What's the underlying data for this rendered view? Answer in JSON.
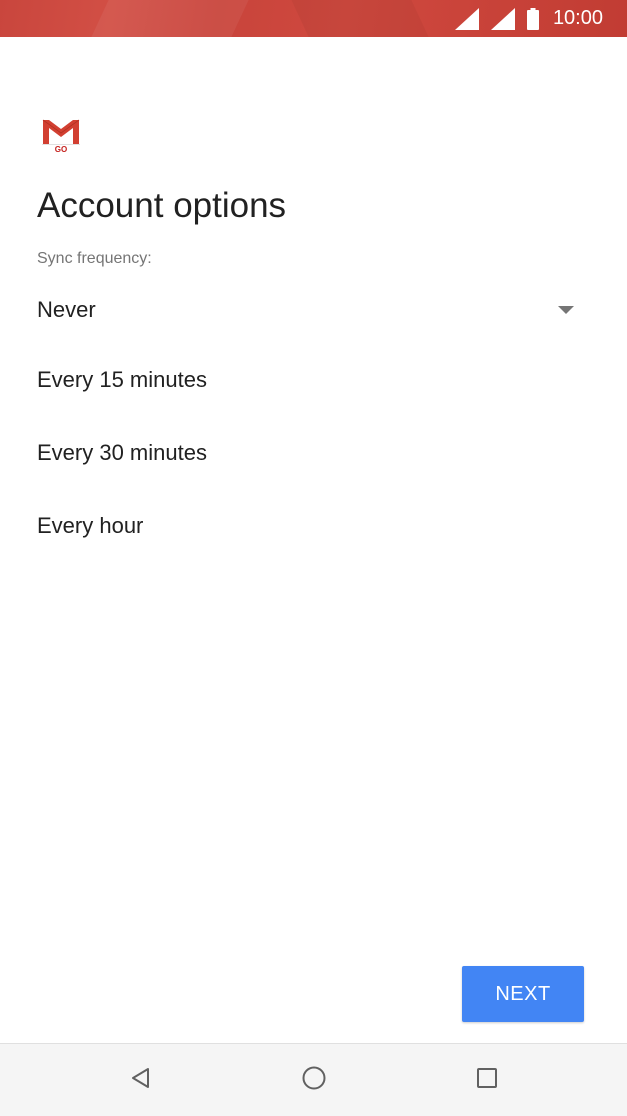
{
  "status_bar": {
    "time": "10:00",
    "icons": [
      "signal-icon",
      "signal-icon",
      "battery-icon"
    ]
  },
  "app": {
    "logo_badge": "GO",
    "logo_icon": "gmail-go-logo-icon"
  },
  "page": {
    "title": "Account options",
    "sync_label": "Sync frequency:"
  },
  "sync_dropdown": {
    "selected": "Never",
    "options": [
      "Never",
      "Every 15 minutes",
      "Every 30 minutes",
      "Every hour"
    ]
  },
  "actions": {
    "next_label": "NEXT"
  },
  "nav_bar": {
    "icons": [
      "back-icon",
      "home-icon",
      "recents-icon"
    ]
  },
  "colors": {
    "status_bar": "#c9463d",
    "accent": "#4285f4",
    "logo_red": "#c5221f"
  }
}
